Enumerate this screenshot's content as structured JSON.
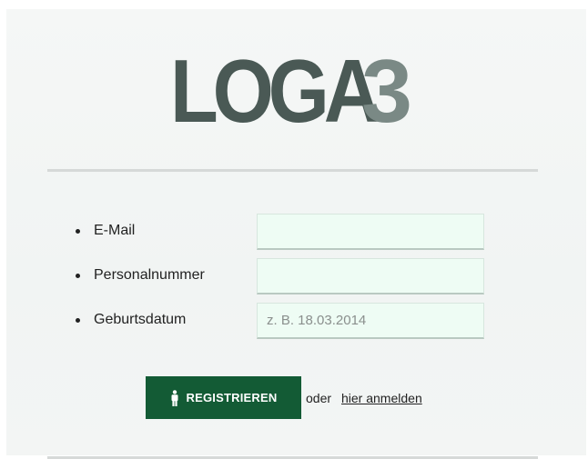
{
  "logo": {
    "text": "LOGA",
    "suffix": "3",
    "primary_color": "#4a5955",
    "accent_color": "#7a8985"
  },
  "form": {
    "fields": [
      {
        "label": "E-Mail",
        "value": "",
        "placeholder": ""
      },
      {
        "label": "Personalnummer",
        "value": "",
        "placeholder": ""
      },
      {
        "label": "Geburtsdatum",
        "value": "",
        "placeholder": "z. B. 18.03.2014"
      }
    ]
  },
  "actions": {
    "register_label": "REGISTRIEREN",
    "register_icon": "person-icon",
    "or_text": "oder",
    "login_link": "hier anmelden"
  },
  "colors": {
    "button_bg": "#135b35",
    "input_bg": "#eefcf4"
  }
}
